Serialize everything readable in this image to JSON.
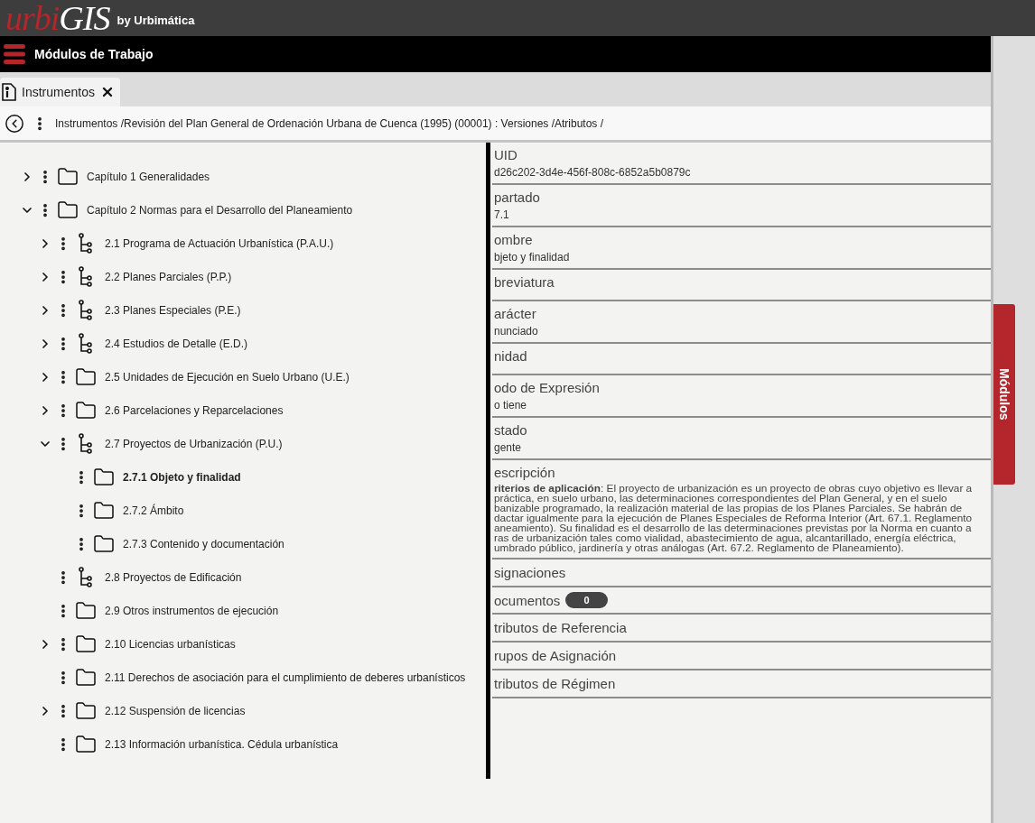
{
  "header": {
    "logo_part_1": "urbi",
    "logo_part_2": "GIS",
    "byline": "by Urbimática"
  },
  "menu_bar": {
    "title": "Módulos de Trabajo"
  },
  "tabs": [
    {
      "label": "Instrumentos",
      "selected": true
    }
  ],
  "breadcrumb": "Instrumentos /Revisión del Plan General de Ordenación Urbana de Cuenca (1995) (00001) : Versiones /Atributos /",
  "tree": [
    {
      "label": "Capítulo 1 Generalidades",
      "kind": "folder",
      "expandable": true,
      "expanded": false,
      "selected": false
    },
    {
      "label": "Capítulo 2 Normas para el Desarrollo del Planeamiento",
      "kind": "folder",
      "expandable": true,
      "expanded": true,
      "selected": false,
      "children": [
        {
          "label": "2.1 Programa de Actuación Urbanística (P.A.U.)",
          "kind": "branch",
          "expandable": true,
          "expanded": false,
          "selected": false
        },
        {
          "label": "2.2 Planes Parciales (P.P.)",
          "kind": "branch",
          "expandable": true,
          "expanded": false,
          "selected": false
        },
        {
          "label": "2.3 Planes Especiales (P.E.)",
          "kind": "branch",
          "expandable": true,
          "expanded": false,
          "selected": false
        },
        {
          "label": "2.4 Estudios de Detalle (E.D.)",
          "kind": "branch",
          "expandable": true,
          "expanded": false,
          "selected": false
        },
        {
          "label": "2.5 Unidades de Ejecución en Suelo Urbano (U.E.)",
          "kind": "folder",
          "expandable": true,
          "expanded": false,
          "selected": false
        },
        {
          "label": "2.6 Parcelaciones y Reparcelaciones",
          "kind": "folder",
          "expandable": true,
          "expanded": false,
          "selected": false
        },
        {
          "label": "2.7 Proyectos de Urbanización (P.U.)",
          "kind": "branch",
          "expandable": true,
          "expanded": true,
          "selected": false,
          "children": [
            {
              "label": "2.7.1 Objeto y finalidad",
              "kind": "folder",
              "expandable": false,
              "selected": true
            },
            {
              "label": "2.7.2 Ámbito",
              "kind": "folder",
              "expandable": false,
              "selected": false
            },
            {
              "label": "2.7.3 Contenido y documentación",
              "kind": "folder",
              "expandable": false,
              "selected": false
            }
          ]
        },
        {
          "label": "2.8 Proyectos de Edificación",
          "kind": "branch",
          "expandable": false,
          "selected": false
        },
        {
          "label": "2.9 Otros instrumentos de ejecución",
          "kind": "folder",
          "expandable": false,
          "selected": false
        },
        {
          "label": "2.10 Licencias urbanísticas",
          "kind": "folder",
          "expandable": true,
          "expanded": false,
          "selected": false
        },
        {
          "label": "2.11 Derechos de asociación para el cumplimiento de deberes urbanísticos",
          "kind": "folder",
          "expandable": false,
          "selected": false
        },
        {
          "label": "2.12 Suspensión de licencias",
          "kind": "folder",
          "expandable": true,
          "expanded": false,
          "selected": false
        },
        {
          "label": "2.13 Información urbanística. Cédula urbanística",
          "kind": "folder",
          "expandable": false,
          "selected": false
        }
      ]
    }
  ],
  "details": [
    {
      "kind": "field",
      "label": "UID",
      "value": "d26c202-3d4e-456f-808c-6852a5b0879c"
    },
    {
      "kind": "field",
      "label": "partado",
      "value": "7.1"
    },
    {
      "kind": "field",
      "label": "ombre",
      "value": "bjeto y finalidad"
    },
    {
      "kind": "field",
      "label": "breviatura"
    },
    {
      "kind": "field",
      "label": "arácter",
      "value": "nunciado"
    },
    {
      "kind": "field",
      "label": "nidad"
    },
    {
      "kind": "field",
      "label": "odo de Expresión",
      "value": "o tiene"
    },
    {
      "kind": "field",
      "label": "stado",
      "value": "gente"
    },
    {
      "kind": "description",
      "label": "escripción",
      "lines": [
        "**riterios de aplicación**: El proyecto de urbanización es un proyecto de obras cuyo objetivo es llevar a",
        "práctica, en suelo urbano, las determinaciones correspondientes del Plan General, y en el suelo",
        "banizable programado, la realización material de las propias de los Planes Parciales. Se habrán de",
        "dactar igualmente para la ejecución de Planes Especiales de Reforma Interior (Art. 67.1. Reglamento",
        "aneamiento). Su finalidad es el desarrollo de las determinaciones previstas por la Norma en cuanto a",
        "ras de urbanización tales como vialidad, abastecimiento de agua, alcantarillado, energía eléctrica,",
        "umbrado público, jardinería y otras análogas (Art. 67.2. Reglamento de Planeamiento)."
      ]
    },
    {
      "kind": "section",
      "label": "signaciones"
    },
    {
      "kind": "count",
      "label": "ocumentos",
      "count": "0"
    },
    {
      "kind": "section",
      "label": "tributos de Referencia"
    },
    {
      "kind": "section",
      "label": "rupos de Asignación"
    },
    {
      "kind": "section",
      "label": "tributos de Régimen"
    }
  ],
  "side_tab": {
    "label": "Módulos"
  }
}
